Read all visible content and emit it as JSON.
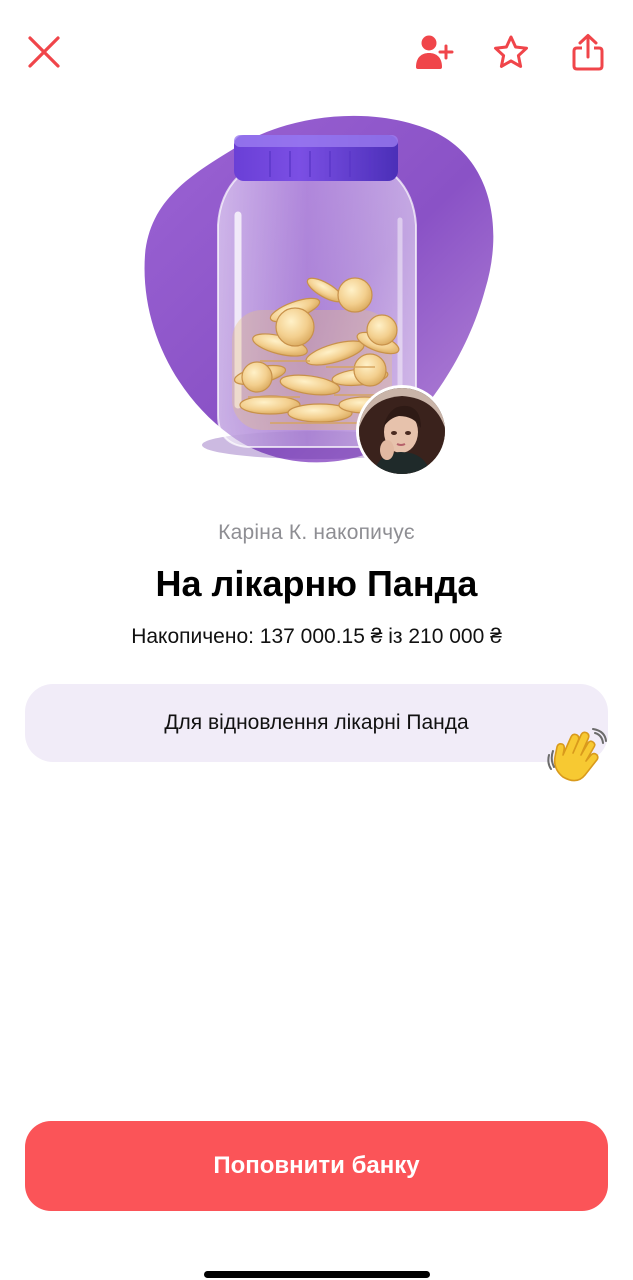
{
  "header": {
    "close_icon": "close-icon",
    "add_friend_icon": "add-user-icon",
    "favorite_icon": "star-icon",
    "share_icon": "share-icon",
    "accent_color": "#f0454a"
  },
  "jar": {
    "owner_line": "Каріна К. накопичує",
    "title": "На лікарню Панда",
    "progress_text": "Накопичено: 137 000.15 ₴ із 210 000 ₴",
    "saved_amount": 137000.15,
    "goal_amount": 210000,
    "currency": "₴",
    "description": "Для відновлення лікарні Панда",
    "description_emoji": "waving-hand"
  },
  "actions": {
    "topup_label": "Поповнити банку",
    "button_color": "#fb5458"
  }
}
